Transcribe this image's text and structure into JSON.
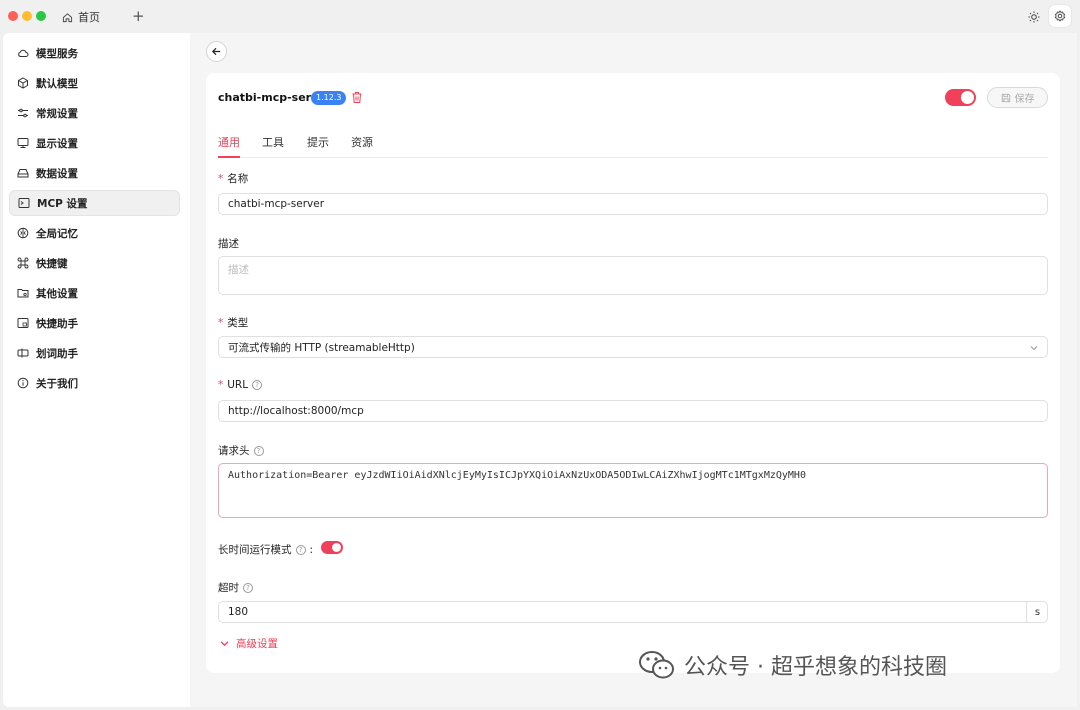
{
  "titlebar": {
    "tab_label": "首页"
  },
  "sidebar": {
    "items": [
      {
        "label": "模型服务",
        "icon": "cloud-icon"
      },
      {
        "label": "默认模型",
        "icon": "cube-icon"
      },
      {
        "label": "常规设置",
        "icon": "sliders-icon"
      },
      {
        "label": "显示设置",
        "icon": "monitor-icon"
      },
      {
        "label": "数据设置",
        "icon": "drive-icon"
      },
      {
        "label": "MCP 设置",
        "icon": "terminal-icon",
        "active": true
      },
      {
        "label": "全局记忆",
        "icon": "brain-icon"
      },
      {
        "label": "快捷键",
        "icon": "command-icon"
      },
      {
        "label": "其他设置",
        "icon": "folder-gear-icon"
      },
      {
        "label": "快捷助手",
        "icon": "app-window-icon"
      },
      {
        "label": "划词助手",
        "icon": "text-cursor-icon"
      },
      {
        "label": "关于我们",
        "icon": "info-icon"
      }
    ]
  },
  "server": {
    "name": "chatbi-mcp-server",
    "version": "1.12.3",
    "enabled": true,
    "save_label": "保存"
  },
  "tabs": [
    "通用",
    "工具",
    "提示",
    "资源"
  ],
  "form": {
    "name_label": "名称",
    "name_value": "chatbi-mcp-server",
    "desc_label": "描述",
    "desc_placeholder": "描述",
    "type_label": "类型",
    "type_value": "可流式传输的 HTTP (streamableHttp)",
    "url_label": "URL",
    "url_value": "http://localhost:8000/mcp",
    "headers_label": "请求头",
    "headers_value": "Authorization=Bearer eyJzdWIiOiAidXNlcjEyMyIsICJpYXQiOiAxNzUxODA5ODIwLCAiZXhwIjogMTc1MTgxMzQyMH0",
    "long_running_label": "长时间运行模式",
    "long_running_enabled": true,
    "timeout_label": "超时",
    "timeout_value": "180",
    "timeout_unit": "s",
    "advanced_label": "高级设置"
  },
  "watermark": {
    "text": "公众号 · 超乎想象的科技圈"
  },
  "colors": {
    "accent": "#f0405a",
    "badge": "#3b82f6"
  }
}
